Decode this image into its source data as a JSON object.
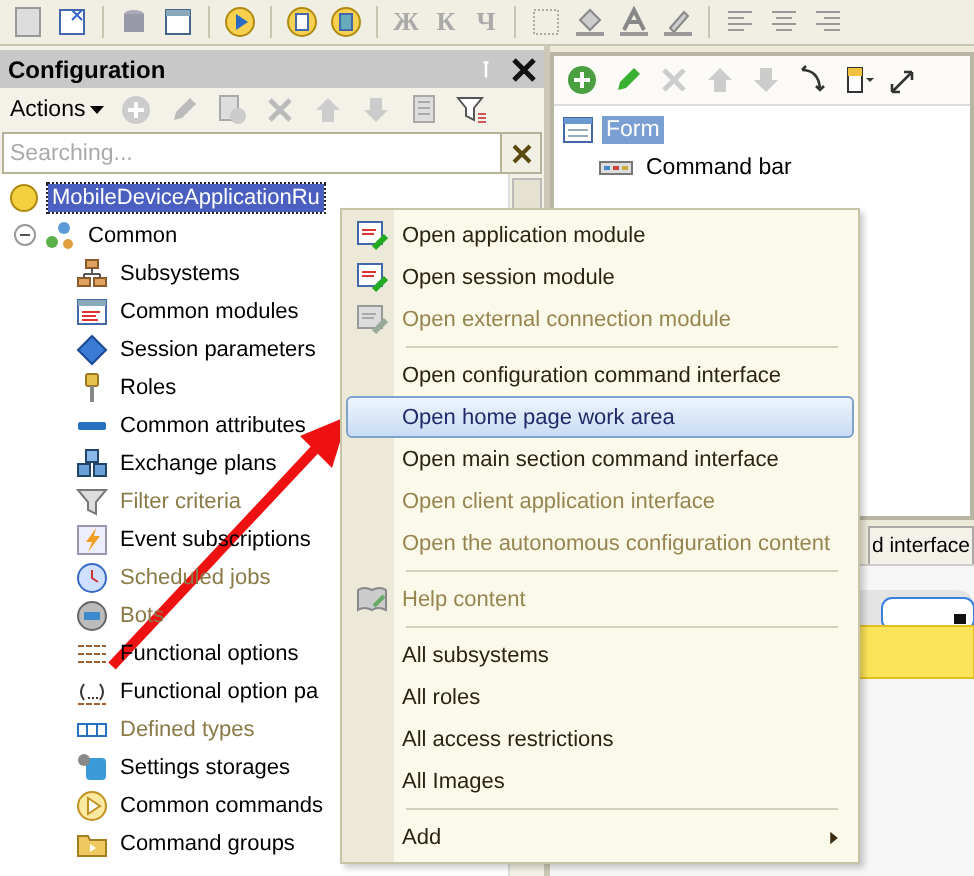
{
  "toolbar": {
    "format_buttons": [
      {
        "label": "Ж",
        "disabled": true
      },
      {
        "label": "К",
        "disabled": true
      },
      {
        "label": "Ч",
        "disabled": true
      }
    ]
  },
  "config_panel": {
    "title": "Configuration",
    "actions_label": "Actions",
    "search": {
      "placeholder": "Searching..."
    },
    "tree": [
      {
        "label": "MobileDeviceApplicationRu",
        "selected": true,
        "children": [
          {
            "label": "Common",
            "selected": false,
            "expanded": true,
            "children": [
              {
                "label": "Subsystems",
                "disabled": false
              },
              {
                "label": "Common modules",
                "disabled": false
              },
              {
                "label": "Session parameters",
                "disabled": false
              },
              {
                "label": "Roles",
                "disabled": false
              },
              {
                "label": "Common attributes",
                "disabled": false
              },
              {
                "label": "Exchange plans",
                "disabled": false
              },
              {
                "label": "Filter criteria",
                "disabled": true
              },
              {
                "label": "Event subscriptions",
                "disabled": false
              },
              {
                "label": "Scheduled jobs",
                "disabled": true
              },
              {
                "label": "Bots",
                "disabled": true
              },
              {
                "label": "Functional options",
                "disabled": false
              },
              {
                "label": "Functional option pa",
                "disabled": false
              },
              {
                "label": "Defined types",
                "disabled": true
              },
              {
                "label": "Settings storages",
                "disabled": false
              },
              {
                "label": "Common commands",
                "disabled": false
              },
              {
                "label": "Command groups",
                "disabled": false
              }
            ]
          }
        ]
      }
    ]
  },
  "form_panel": {
    "tree": [
      {
        "label": "Form",
        "selected": true,
        "children": [
          {
            "label": "Command bar",
            "selected": false
          }
        ]
      }
    ],
    "tab": {
      "label": "d interface"
    }
  },
  "context_menu": {
    "items": [
      {
        "kind": "item",
        "label": "Open application module",
        "icon": true,
        "disabled": false,
        "selected": false
      },
      {
        "kind": "item",
        "label": "Open session module",
        "icon": true,
        "disabled": false,
        "selected": false
      },
      {
        "kind": "item",
        "label": "Open external connection module",
        "icon": true,
        "disabled": true,
        "selected": false
      },
      {
        "kind": "separator"
      },
      {
        "kind": "item",
        "label": "Open configuration command interface",
        "icon": false,
        "disabled": false,
        "selected": false
      },
      {
        "kind": "item",
        "label": "Open home page work area",
        "icon": false,
        "disabled": false,
        "selected": true
      },
      {
        "kind": "item",
        "label": "Open main section command interface",
        "icon": false,
        "disabled": false,
        "selected": false
      },
      {
        "kind": "item",
        "label": "Open client application interface",
        "icon": false,
        "disabled": true,
        "selected": false
      },
      {
        "kind": "item",
        "label": "Open the autonomous configuration content",
        "icon": false,
        "disabled": true,
        "selected": false
      },
      {
        "kind": "separator"
      },
      {
        "kind": "item",
        "label": "Help content",
        "icon": true,
        "disabled": true,
        "selected": false
      },
      {
        "kind": "separator"
      },
      {
        "kind": "item",
        "label": "All subsystems",
        "icon": false,
        "disabled": false,
        "selected": false
      },
      {
        "kind": "item",
        "label": "All roles",
        "icon": false,
        "disabled": false,
        "selected": false
      },
      {
        "kind": "item",
        "label": "All access restrictions",
        "icon": false,
        "disabled": false,
        "selected": false
      },
      {
        "kind": "item",
        "label": "All Images",
        "icon": false,
        "disabled": false,
        "selected": false
      },
      {
        "kind": "separator"
      },
      {
        "kind": "submenu",
        "label": "Add",
        "icon": false,
        "disabled": false,
        "selected": false
      }
    ]
  }
}
